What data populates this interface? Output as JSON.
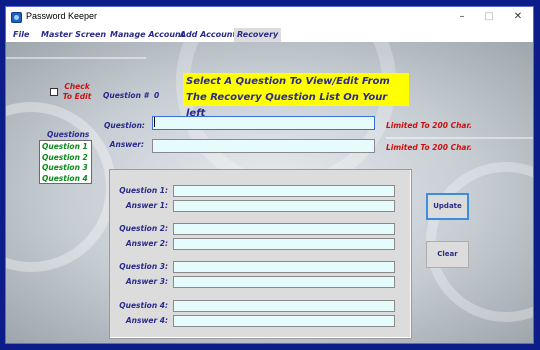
{
  "window": {
    "title": "Password Keeper",
    "minimize": "–",
    "maximize": "□",
    "close": "✕"
  },
  "menu": [
    "File",
    "Master Screen",
    "Manage Account",
    "Add Account",
    "Recovery"
  ],
  "check": {
    "label": "Check To Edit",
    "checked": false
  },
  "question_number": {
    "label": "Question #",
    "value": "0"
  },
  "banner": [
    "Select A Question To View/Edit From",
    "The Recovery Question List On Your left"
  ],
  "questions_list": {
    "title": "Questions",
    "items": [
      "Question 1",
      "Question 2",
      "Question 3",
      "Question 4"
    ]
  },
  "edit": {
    "question_label": "Question:",
    "answer_label": "Answer:",
    "question_value": "",
    "answer_value": "",
    "limit_text": "Limited To 200 Char."
  },
  "panel": {
    "rows": [
      {
        "q_label": "Question 1:",
        "a_label": "Answer 1:",
        "q_value": "",
        "a_value": ""
      },
      {
        "q_label": "Question 2:",
        "a_label": "Answer 2:",
        "q_value": "",
        "a_value": ""
      },
      {
        "q_label": "Question 3:",
        "a_label": "Answer 3:",
        "q_value": "",
        "a_value": ""
      },
      {
        "q_label": "Question 4:",
        "a_label": "Answer 4:",
        "q_value": "",
        "a_value": ""
      }
    ]
  },
  "buttons": {
    "update": "Update",
    "clear": "Clear"
  },
  "colors": {
    "label_blue": "#2a2a8c",
    "warning_red": "#d01010",
    "list_green": "#0a8a1a",
    "banner_yellow": "#ffff00",
    "input_bg": "#e6fcfc"
  }
}
